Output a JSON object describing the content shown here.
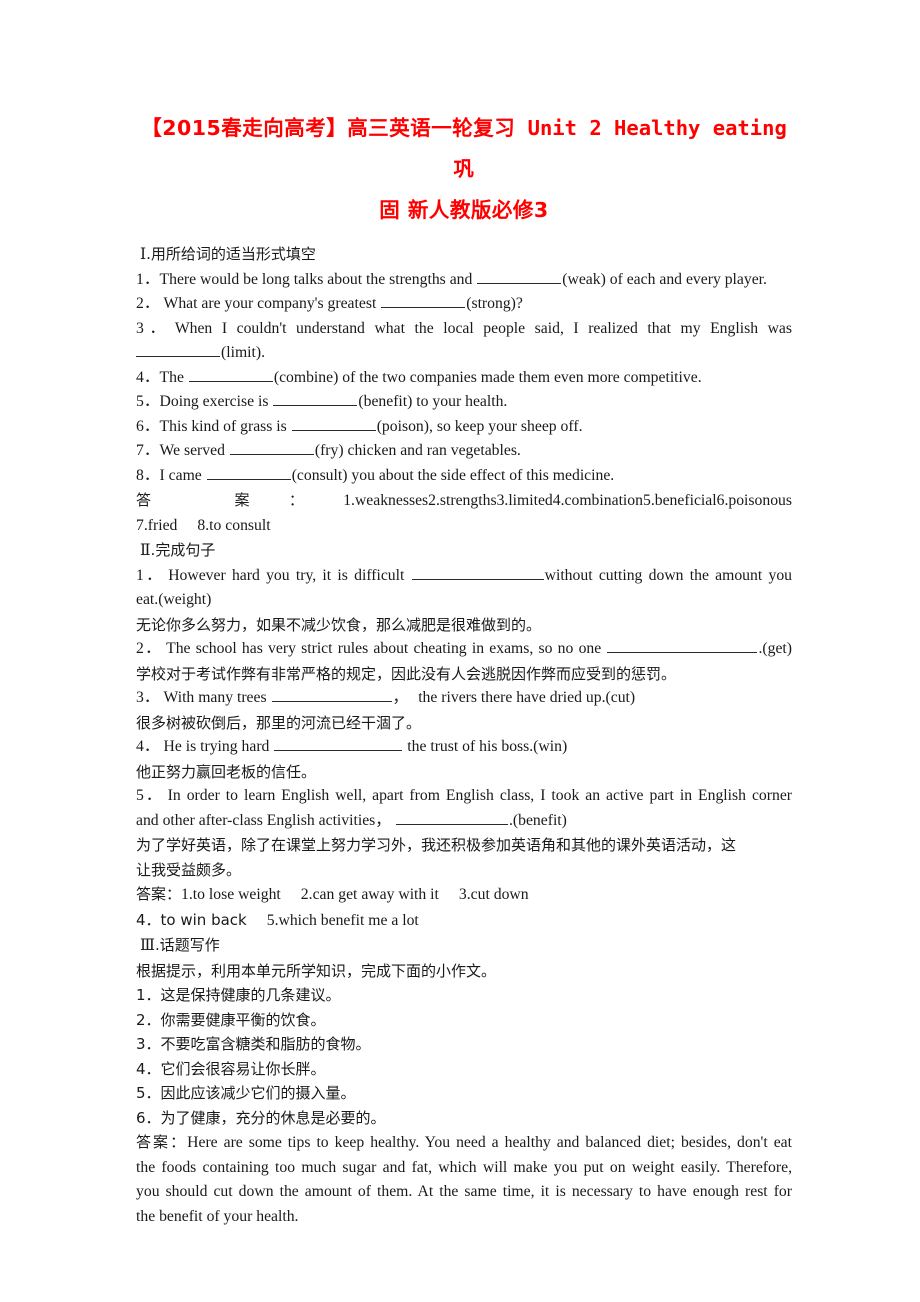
{
  "title": {
    "bracket_open": "【",
    "bracket_label": "2015春走向高考",
    "bracket_close": "】",
    "cn_prefix": "高三英语一轮复习",
    "en_unit": "Unit 2 Healthy eating",
    "cn_suffix_line1": "巩",
    "line2": "固 新人教版必修3",
    "color": "#ff0000"
  },
  "section1": {
    "heading_roman": "Ⅰ",
    "heading_text": ".用所给词的适当形式填空",
    "items": [
      {
        "num": "1．",
        "a": "There would be long talks about the strengths and",
        "b": "(weak) of each and every player."
      },
      {
        "num": "2．",
        "a": "What are your company's greatest",
        "b": "(strong)?"
      },
      {
        "num": "3．",
        "a": "When I couldn't understand what the local people said, I realized that my English was",
        "b": "(limit)."
      },
      {
        "num": "4．",
        "a": "The",
        "b": "(combine) of the two companies made them even more competitive."
      },
      {
        "num": "5．",
        "a": "Doing exercise is",
        "b": "(benefit) to your health."
      },
      {
        "num": "6．",
        "a": "This kind of grass is",
        "b": "(poison), so keep your sheep off."
      },
      {
        "num": "7．",
        "a": "We served",
        "b": "(fry) chicken and ran vegetables."
      },
      {
        "num": "8．",
        "a": "I came",
        "b": "(consult) you about the side effect of this medicine."
      }
    ],
    "answer_label": "答 案：",
    "answers_line1": [
      "1.weaknesses",
      "2.strengths",
      "3.limited",
      "4.combination",
      "5.beneficial",
      "6.poisonous"
    ],
    "answers_line2": [
      "7.fried",
      "8.to consult"
    ]
  },
  "section2": {
    "heading_roman": "Ⅱ",
    "heading_text": ".完成句子",
    "q1_num": "1．",
    "q1_a": "However hard you try, it is difficult",
    "q1_b": "without cutting down the amount you",
    "q1_c": "eat.(weight)",
    "q1_cn": "无论你多么努力，如果不减少饮食，那么减肥是很难做到的。",
    "q2_num": "2．",
    "q2_a": "The school has very strict rules about cheating in exams, so no one",
    "q2_b": ".(get)",
    "q2_cn": "学校对于考试作弊有非常严格的规定，因此没有人会逃脱因作弊而应受到的惩罚。",
    "q3_num": "3．",
    "q3_a": "With many trees",
    "q3_b": "，",
    "q3_c": "the rivers there have dried up.(cut)",
    "q3_cn": "很多树被砍倒后，那里的河流已经干涸了。",
    "q4_num": "4．",
    "q4_a": "He is trying hard",
    "q4_b": "the trust of his boss.(win)",
    "q4_cn": "他正努力赢回老板的信任。",
    "q5_num": "5．",
    "q5_a": "In order to learn English well, apart from English class, I took an active part in English corner",
    "q5_b": "and other after-class English activities，",
    "q5_c": ".(benefit)",
    "q5_cn1": "为了学好英语，除了在课堂上努力学习外，我还积极参加英语角和其他的课外英语活动，这",
    "q5_cn2": "让我受益颇多。",
    "answer_label": "答案：",
    "answers_line1": [
      "1.to lose weight",
      "2.can get away with it",
      "3.cut down"
    ],
    "answers_line2": [
      "4．to win back",
      "5.which benefit me a lot"
    ]
  },
  "section3": {
    "heading_roman": "Ⅲ",
    "heading_text": ".话题写作",
    "instruction": "根据提示，利用本单元所学知识，完成下面的小作文。",
    "prompts": [
      {
        "num": "1．",
        "text": "这是保持健康的几条建议。"
      },
      {
        "num": "2．",
        "text": "你需要健康平衡的饮食。"
      },
      {
        "num": "3．",
        "text": "不要吃富含糖类和脂肪的食物。"
      },
      {
        "num": "4．",
        "text": "它们会很容易让你长胖。"
      },
      {
        "num": "5．",
        "text": "因此应该减少它们的摄入量。"
      },
      {
        "num": "6．",
        "text": "为了健康，充分的休息是必要的。"
      }
    ],
    "answer_label": "答案：",
    "answer_l1": "Here are some tips to keep healthy. You need a healthy and balanced diet; besides, don't eat",
    "answer_l2": "the foods containing too much sugar and fat, which will make you put on weight easily. Therefore,",
    "answer_l3": "you should cut down the amount of them. At the same time, it is necessary to have enough rest for",
    "answer_l4": "the benefit of your health."
  }
}
